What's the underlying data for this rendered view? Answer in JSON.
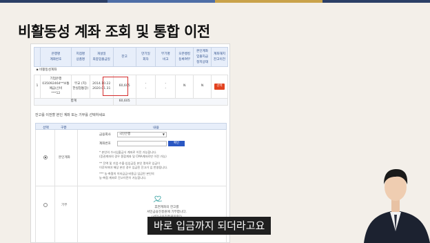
{
  "slide": {
    "title": "비활동성 계좌 조회 및 통합 이전"
  },
  "accounts_table": {
    "headers": [
      [
        "은행명",
        "계좌번호"
      ],
      [
        "지점명",
        "상품명"
      ],
      [
        "개설일",
        "최종입출금일"
      ],
      [
        "잔고"
      ],
      [
        "만기일",
        "회차"
      ],
      [
        "부기명",
        "비고"
      ],
      [
        "오픈뱅킹",
        "등록여부"
      ],
      [
        "본인계좌",
        "입출지급",
        "정지상태"
      ],
      [
        "계좌해지",
        "잔고이전"
      ]
    ],
    "section_label": "비활동성계좌",
    "row": {
      "no": "1",
      "bank": "기업은행",
      "account": "035092464**보통예금(신비",
      "account2": "***12",
      "branch": "무교 (지)",
      "product": "한실업통장)",
      "open_date": "2014.10.22",
      "last_date": "2020.01.31",
      "balance": "60,605",
      "maturity": "-",
      "round": "-",
      "memo_name": "-",
      "memo": "-",
      "openbanking": "N",
      "suspended": "N",
      "action": "선택"
    },
    "total_label": "합계",
    "total_value": "60,605"
  },
  "transfer": {
    "instruction": "잔고를 이전할 본인 계좌 또는 기부를 선택하세요",
    "headers": {
      "select": "선택",
      "type": "구분",
      "content": "내용"
    },
    "own_account": {
      "label": "본인계좌",
      "bank_field_label": "금융회사",
      "bank_value": "국민은행",
      "account_field_label": "계좌번호",
      "confirm_button": "확인",
      "notes": [
        "* 본인의 수시입출금식 계좌로 이전 가능합니다.",
        "(증권계좌의 경우 종합계좌 및 CMA계좌로만 이전 가능)",
        "** 잔액 및 기업·수출·입입금등 본인 명의로 입금이",
        "이루어져야 해당 본인 경우 입금된 잔고가 입 반영됩니다.",
        "*** 농·축협의 이자금금·비용금 입금된 본인의",
        "농·축협 계좌로 잔고이전이 가능합니다."
      ]
    },
    "donation": {
      "label": "기부",
      "notes": [
        "휴면계좌의 잔고를",
        "서민금융진흥원에 기부합니다.",
        "(서민금융진흥원이란?)"
      ]
    }
  },
  "caption": "바로 입금까지 되더라고요",
  "colors": {
    "highlight_box": "#d42b2b",
    "select_button": "#e2421f",
    "confirm_button": "#2a57c3",
    "header_fill": "#e7eefa",
    "slide_background": "#f3efe9"
  }
}
